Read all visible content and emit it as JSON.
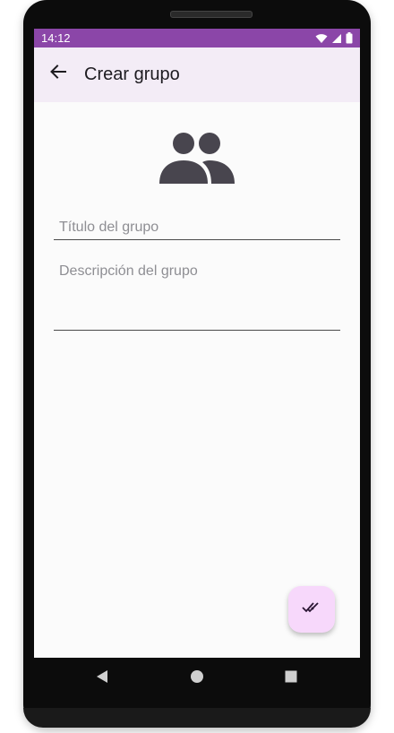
{
  "status_bar": {
    "time": "14:12",
    "background": "#8b46a8",
    "icons": [
      "wifi-icon",
      "signal-icon",
      "battery-icon"
    ]
  },
  "app_bar": {
    "title": "Crear grupo",
    "background": "#f3ecf6",
    "back_icon": "arrow-back-icon"
  },
  "avatar": {
    "icon": "group-icon",
    "color": "#48454e"
  },
  "form": {
    "title_placeholder": "Título del grupo",
    "title_value": "",
    "description_placeholder": "Descripción del grupo",
    "description_value": ""
  },
  "fab": {
    "icon": "done-all-icon",
    "background": "#f7d8fb"
  },
  "nav": {
    "icons": [
      "back-triangle-icon",
      "home-circle-icon",
      "recents-square-icon"
    ]
  }
}
